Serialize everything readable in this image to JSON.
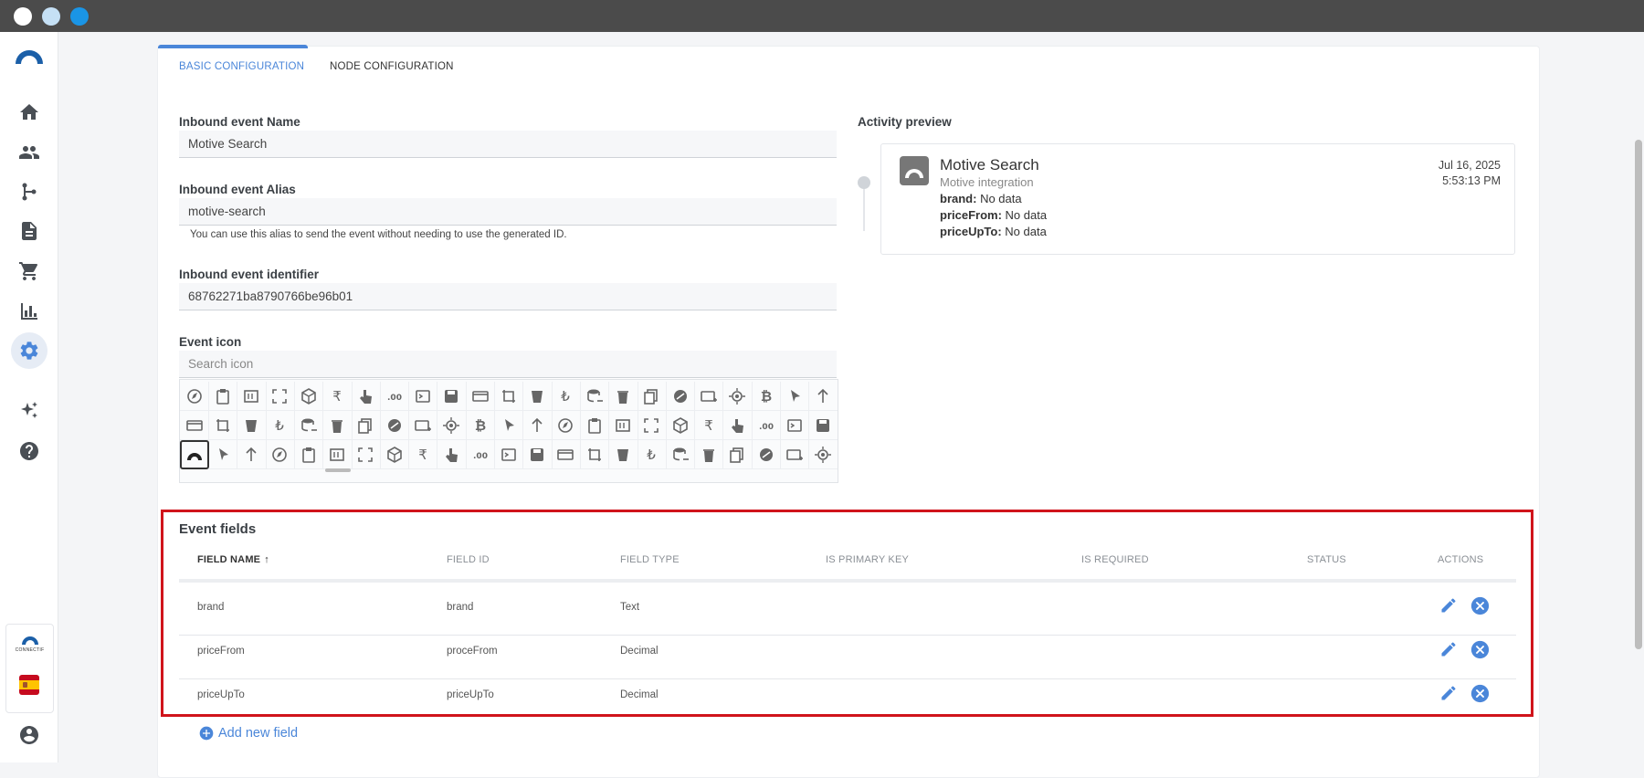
{
  "colors": {
    "accent": "#4a86d9",
    "highlight": "#d0141b",
    "titlebar": "#4b4b4b",
    "dot1": "#ffffff",
    "dot2": "#c5e0f5",
    "dot3": "#1a95e6"
  },
  "sidebar": {
    "items": [
      {
        "icon": "home-icon"
      },
      {
        "icon": "users-icon"
      },
      {
        "icon": "flow-icon"
      },
      {
        "icon": "document-icon"
      },
      {
        "icon": "cart-icon"
      },
      {
        "icon": "chart-icon"
      },
      {
        "icon": "gear-icon",
        "active": true
      },
      {
        "icon": "sparkle-icon"
      },
      {
        "icon": "help-icon"
      }
    ],
    "brand_name": "CONNECTIF",
    "flag": "spain-flag-icon",
    "profile": "account-icon"
  },
  "tabs": [
    {
      "label": "Basic configuration",
      "active": true
    },
    {
      "label": "Node configuration",
      "active": false
    }
  ],
  "form": {
    "name_label": "Inbound event Name",
    "name_value": "Motive Search",
    "alias_label": "Inbound event Alias",
    "alias_value": "motive-search",
    "alias_hint": "You can use this alias to send the event without needing to use the generated ID.",
    "id_label": "Inbound event identifier",
    "id_value": "68762271ba8790766be96b01",
    "icon_label": "Event icon",
    "icon_search_placeholder": "Search icon"
  },
  "preview": {
    "label": "Activity preview",
    "title": "Motive Search",
    "subtitle": "Motive integration",
    "date": "Jul 16, 2025",
    "time": "5:53:13 PM",
    "fields": [
      {
        "key": "brand:",
        "value": "No data"
      },
      {
        "key": "priceFrom:",
        "value": "No data"
      },
      {
        "key": "priceUpTo:",
        "value": "No data"
      }
    ]
  },
  "event_fields": {
    "title": "Event fields",
    "columns": [
      "Field name",
      "Field ID",
      "Field type",
      "Is primary key",
      "Is required",
      "Status",
      "Actions"
    ],
    "rows": [
      {
        "name": "brand",
        "id": "brand",
        "type": "Text"
      },
      {
        "name": "priceFrom",
        "id": "proceFrom",
        "type": "Decimal"
      },
      {
        "name": "priceUpTo",
        "id": "priceUpTo",
        "type": "Decimal"
      }
    ],
    "add_label": "Add new field"
  }
}
